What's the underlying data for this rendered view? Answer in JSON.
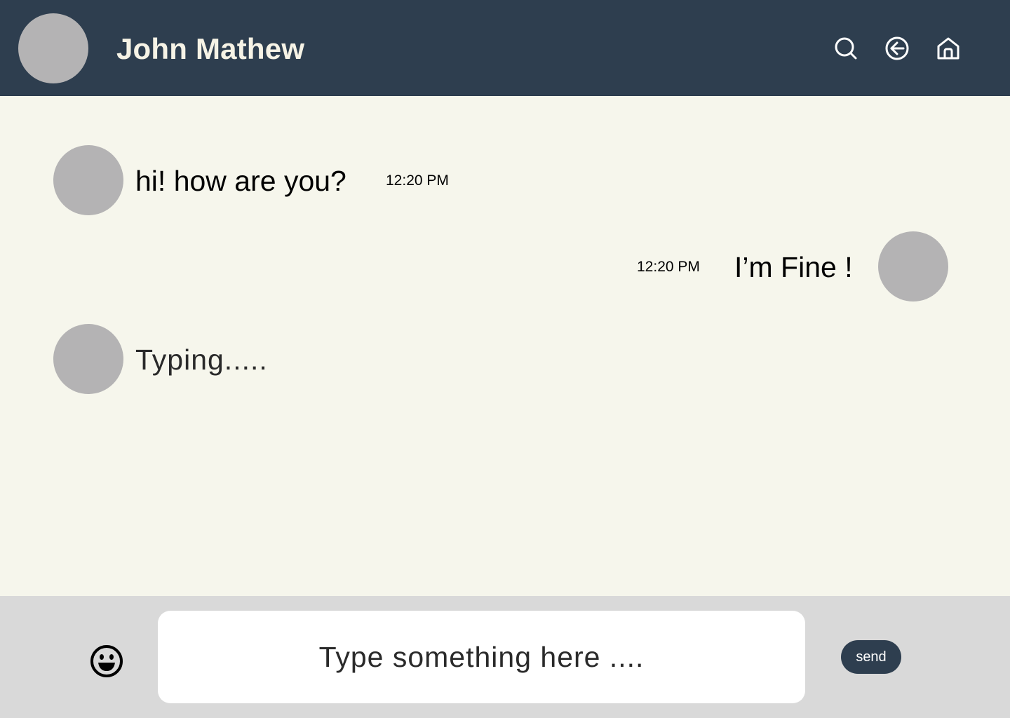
{
  "header": {
    "contact_name": "John Mathew",
    "icons": [
      "search-icon",
      "back-arrow-icon",
      "home-icon"
    ]
  },
  "messages": [
    {
      "direction": "incoming",
      "text": "hi! how are you?",
      "time": "12:20 PM"
    },
    {
      "direction": "outgoing",
      "text": "I’m Fine !",
      "time": "12:20 PM"
    }
  ],
  "typing_indicator": "Typing.....",
  "composer": {
    "placeholder": "Type something here ....",
    "send_label": "send",
    "emoji_icon": "smiley-icon"
  },
  "colors": {
    "header_bg": "#2e3e4f",
    "chat_bg": "#f6f6ec",
    "composer_bg": "#d9d9d9",
    "avatar": "#b4b3b4",
    "send_bg": "#2e3e4f"
  }
}
